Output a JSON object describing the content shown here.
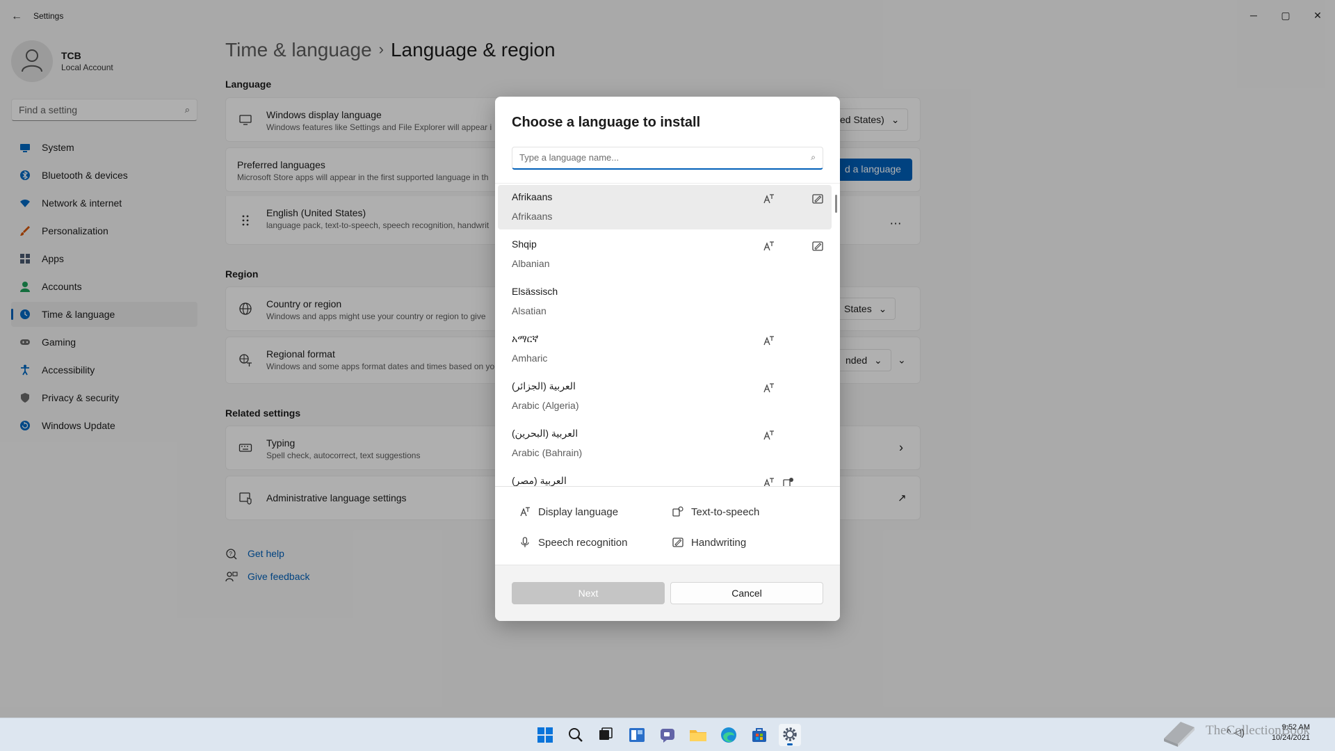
{
  "window": {
    "app_title": "Settings",
    "back_glyph": "←",
    "controls": {
      "minimize": "─",
      "maximize": "▢",
      "close": "✕"
    }
  },
  "user": {
    "name": "TCB",
    "account_type": "Local Account"
  },
  "search": {
    "placeholder": "Find a setting",
    "icon": "search-icon"
  },
  "nav": {
    "items": [
      {
        "label": "System",
        "icon": "system-icon",
        "color": "#0067c0"
      },
      {
        "label": "Bluetooth & devices",
        "icon": "bluetooth-icon",
        "color": "#0067c0"
      },
      {
        "label": "Network & internet",
        "icon": "wifi-icon",
        "color": "#0067c0"
      },
      {
        "label": "Personalization",
        "icon": "brush-icon",
        "color": "#d35400"
      },
      {
        "label": "Apps",
        "icon": "apps-icon",
        "color": "#4a5a70"
      },
      {
        "label": "Accounts",
        "icon": "person-icon",
        "color": "#1e9e5a"
      },
      {
        "label": "Time & language",
        "icon": "globe-clock-icon",
        "color": "#0067c0"
      },
      {
        "label": "Gaming",
        "icon": "gamepad-icon",
        "color": "#6b6b6b"
      },
      {
        "label": "Accessibility",
        "icon": "accessibility-icon",
        "color": "#0067c0"
      },
      {
        "label": "Privacy & security",
        "icon": "shield-icon",
        "color": "#6b6b6b"
      },
      {
        "label": "Windows Update",
        "icon": "update-icon",
        "color": "#0067c0"
      }
    ],
    "active_index": 6
  },
  "breadcrumb": {
    "parent": "Time & language",
    "separator": "›",
    "current": "Language & region"
  },
  "sections": {
    "language": "Language",
    "region": "Region",
    "related": "Related settings"
  },
  "cards": {
    "display_language": {
      "title": "Windows display language",
      "subtitle": "Windows features like Settings and File Explorer will appear i",
      "value": "ed States)",
      "chevron": "⌄"
    },
    "preferred": {
      "title": "Preferred languages",
      "subtitle": "Microsoft Store apps will appear in the first supported language in th",
      "button": "d a language"
    },
    "english": {
      "title": "English (United States)",
      "subtitle": "language pack, text-to-speech, speech recognition, handwrit",
      "more": "…"
    },
    "country": {
      "title": "Country or region",
      "subtitle": "Windows and apps might use your country or region to give",
      "value": "States",
      "chevron": "⌄"
    },
    "regional": {
      "title": "Regional format",
      "subtitle": "Windows and some apps format dates and times based on yo",
      "value": "nded",
      "chevron": "⌄",
      "expand": "⌄"
    },
    "typing": {
      "title": "Typing",
      "subtitle": "Spell check, autocorrect, text suggestions",
      "arrow": "›"
    },
    "admin": {
      "title": "Administrative language settings",
      "arrow": "↗"
    }
  },
  "help_links": [
    {
      "label": "Get help",
      "icon": "help-icon"
    },
    {
      "label": "Give feedback",
      "icon": "feedback-icon"
    }
  ],
  "dialog": {
    "title": "Choose a language to install",
    "search_placeholder": "Type a language name...",
    "languages": [
      {
        "native": "Afrikaans",
        "english": "Afrikaans",
        "display": true,
        "handwriting": true
      },
      {
        "native": "Shqip",
        "english": "Albanian",
        "display": true,
        "handwriting": true
      },
      {
        "native": "Elsässisch",
        "english": "Alsatian",
        "display": false,
        "handwriting": false
      },
      {
        "native": "አማርኛ",
        "english": "Amharic",
        "display": true,
        "handwriting": false
      },
      {
        "native": "العربية (الجزائر)",
        "english": "Arabic (Algeria)",
        "display": true,
        "handwriting": false
      },
      {
        "native": "العربية (البحرين)",
        "english": "Arabic (Bahrain)",
        "display": true,
        "handwriting": false
      },
      {
        "native": "العربية (مصر)",
        "english": "",
        "display": true,
        "tts": true,
        "handwriting": false
      }
    ],
    "selected_index": 0,
    "legend": {
      "display": "Display language",
      "tts": "Text-to-speech",
      "speech": "Speech recognition",
      "handwriting": "Handwriting"
    },
    "buttons": {
      "next": "Next",
      "cancel": "Cancel"
    }
  },
  "taskbar": {
    "icons": [
      "start-icon",
      "search-icon",
      "task-view-icon",
      "widgets-icon",
      "chat-icon",
      "file-explorer-icon",
      "edge-icon",
      "store-icon",
      "settings-icon"
    ],
    "active": "settings-icon",
    "tray": "^ ◁)",
    "time": "9:52 AM",
    "date": "10/24/2021"
  },
  "watermark": "TheCollectionBook",
  "accent": "#005fb8"
}
